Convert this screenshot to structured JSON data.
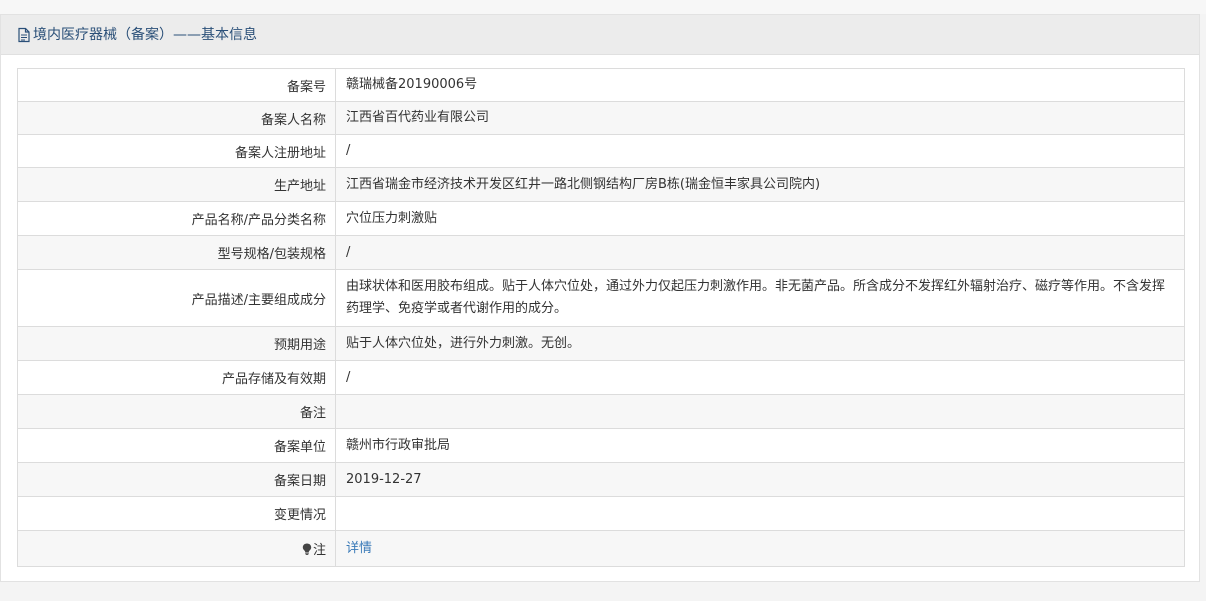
{
  "header": {
    "title": "境内医疗器械（备案）——基本信息",
    "icon": "document-icon"
  },
  "rows": [
    {
      "label": "备案号",
      "value": "赣瑞械备20190006号"
    },
    {
      "label": "备案人名称",
      "value": "江西省百代药业有限公司"
    },
    {
      "label": "备案人注册地址",
      "value": " /"
    },
    {
      "label": "生产地址",
      "value": "江西省瑞金市经济技术开发区红井一路北侧钢结构厂房B栋(瑞金恒丰家具公司院内)"
    },
    {
      "label": "产品名称/产品分类名称",
      "value": "穴位压力刺激贴"
    },
    {
      "label": "型号规格/包装规格",
      "value": "/"
    },
    {
      "label": "产品描述/主要组成成分",
      "value": "由球状体和医用胶布组成。贴于人体穴位处，通过外力仅起压力刺激作用。非无菌产品。所含成分不发挥红外辐射治疗、磁疗等作用。不含发挥药理学、免疫学或者代谢作用的成分。"
    },
    {
      "label": "预期用途",
      "value": "贴于人体穴位处，进行外力刺激。无创。"
    },
    {
      "label": "产品存储及有效期",
      "value": "/"
    },
    {
      "label": "备注",
      "value": ""
    },
    {
      "label": "备案单位",
      "value": "赣州市行政审批局"
    },
    {
      "label": "备案日期",
      "value": "2019-12-27"
    },
    {
      "label": "变更情况",
      "value": ""
    }
  ],
  "note_row": {
    "label": "注",
    "link_text": "详情",
    "icon": "lightbulb-icon"
  },
  "colors": {
    "title": "#2a4f78",
    "link": "#3a7ab8",
    "border": "#dcdcdc",
    "header_bg": "#ececec"
  }
}
